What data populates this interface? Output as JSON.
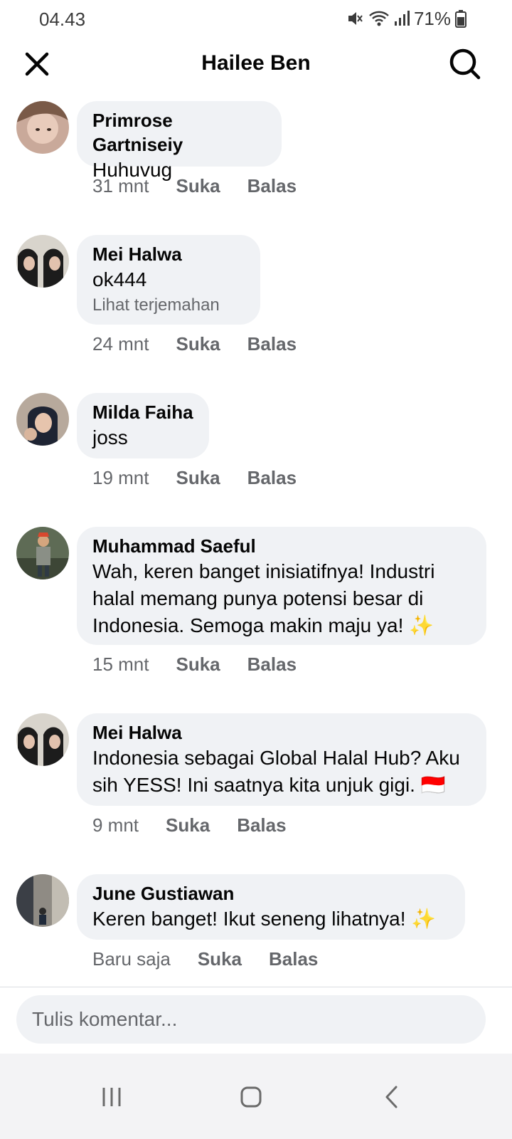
{
  "status_bar": {
    "time": "04.43",
    "battery": "71%"
  },
  "header": {
    "title": "Hailee Ben"
  },
  "comments": [
    {
      "name": "Primrose Gartniseiy",
      "lines": [
        "Huhuvug"
      ],
      "translate": "",
      "time": "31 mnt",
      "like": "Suka",
      "reply": "Balas"
    },
    {
      "name": "Mei Halwa",
      "lines": [
        "ok444"
      ],
      "translate": "Lihat terjemahan",
      "time": "24 mnt",
      "like": "Suka",
      "reply": "Balas"
    },
    {
      "name": "Milda Faiha",
      "lines": [
        "joss"
      ],
      "translate": "",
      "time": "19 mnt",
      "like": "Suka",
      "reply": "Balas"
    },
    {
      "name": "Muhammad Saeful",
      "lines": [
        "Wah, keren banget inisiatifnya! Industri",
        "halal memang punya potensi besar di",
        "Indonesia. Semoga makin maju ya! ✨"
      ],
      "translate": "",
      "time": "15 mnt",
      "like": "Suka",
      "reply": "Balas"
    },
    {
      "name": "Mei Halwa",
      "lines": [
        "Indonesia sebagai Global Halal Hub? Aku",
        "sih YESS! Ini saatnya kita unjuk gigi. 🇮🇩"
      ],
      "translate": "",
      "time": "9 mnt",
      "like": "Suka",
      "reply": "Balas"
    },
    {
      "name": "June Gustiawan",
      "lines": [
        "Keren banget! Ikut seneng lihatnya! ✨"
      ],
      "translate": "",
      "time": "Baru saja",
      "like": "Suka",
      "reply": "Balas"
    }
  ],
  "composer": {
    "placeholder": "Tulis komentar..."
  },
  "icons": {
    "close": "close-icon",
    "search": "search-icon",
    "mute": "mute-icon",
    "wifi": "wifi-icon",
    "signal": "signal-icon",
    "battery": "battery-icon",
    "recents": "recents-icon",
    "home": "home-icon",
    "back": "back-icon"
  },
  "colors": {
    "bubble": "#f0f2f5",
    "meta_text": "#65676b",
    "text": "#050505"
  }
}
